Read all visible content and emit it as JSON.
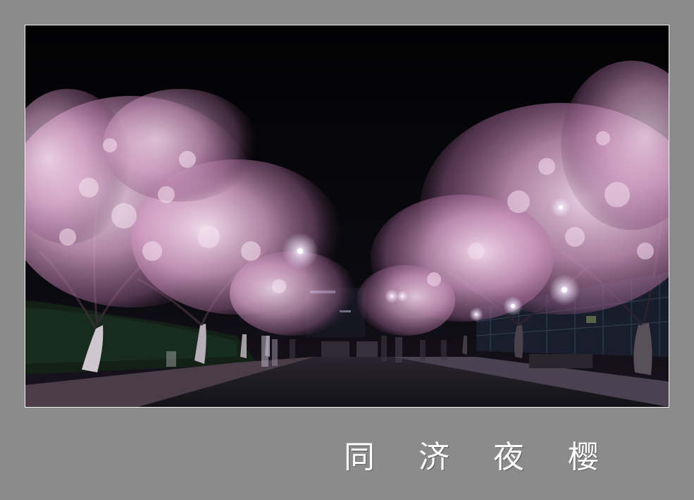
{
  "caption": {
    "text": "同 济 夜 樱"
  },
  "colors": {
    "background": "#8b8b8b",
    "frame_border": "#f2f2f2",
    "night_sky": "#050507",
    "blossom_light": "#f3d6ea",
    "blossom_mid": "#c98ab8",
    "blossom_dark": "#7a4a6e",
    "road": "#1b1b20"
  },
  "photo": {
    "subject": "cherry-blossom-avenue-at-night"
  }
}
